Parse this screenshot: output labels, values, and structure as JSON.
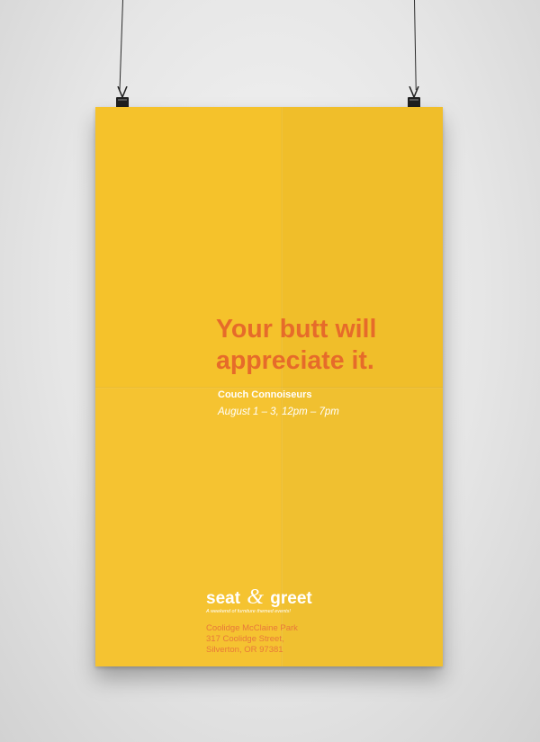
{
  "poster": {
    "headline_line1": "Your butt will",
    "headline_line2": "appreciate it.",
    "event_name": "Couch Connoiseurs",
    "dates": "August 1 – 3, 12pm – 7pm",
    "logo_word1": "seat",
    "logo_amp": "&",
    "logo_word2": "greet",
    "tagline": "A weekend of furniture themed events!",
    "address_line1": "Coolidge McClaine Park",
    "address_line2": "317 Coolidge Street,",
    "address_line3": "Silverton, OR 97381"
  },
  "colors": {
    "poster_background": "#f5c22b",
    "headline": "#e66b2a",
    "address": "#e8793a",
    "white_text": "#ffffff",
    "wall": "#e6e6e6",
    "clip": "#1f1f1f"
  },
  "icons": {
    "left_clip": "binder-clip-icon",
    "right_clip": "binder-clip-icon"
  }
}
